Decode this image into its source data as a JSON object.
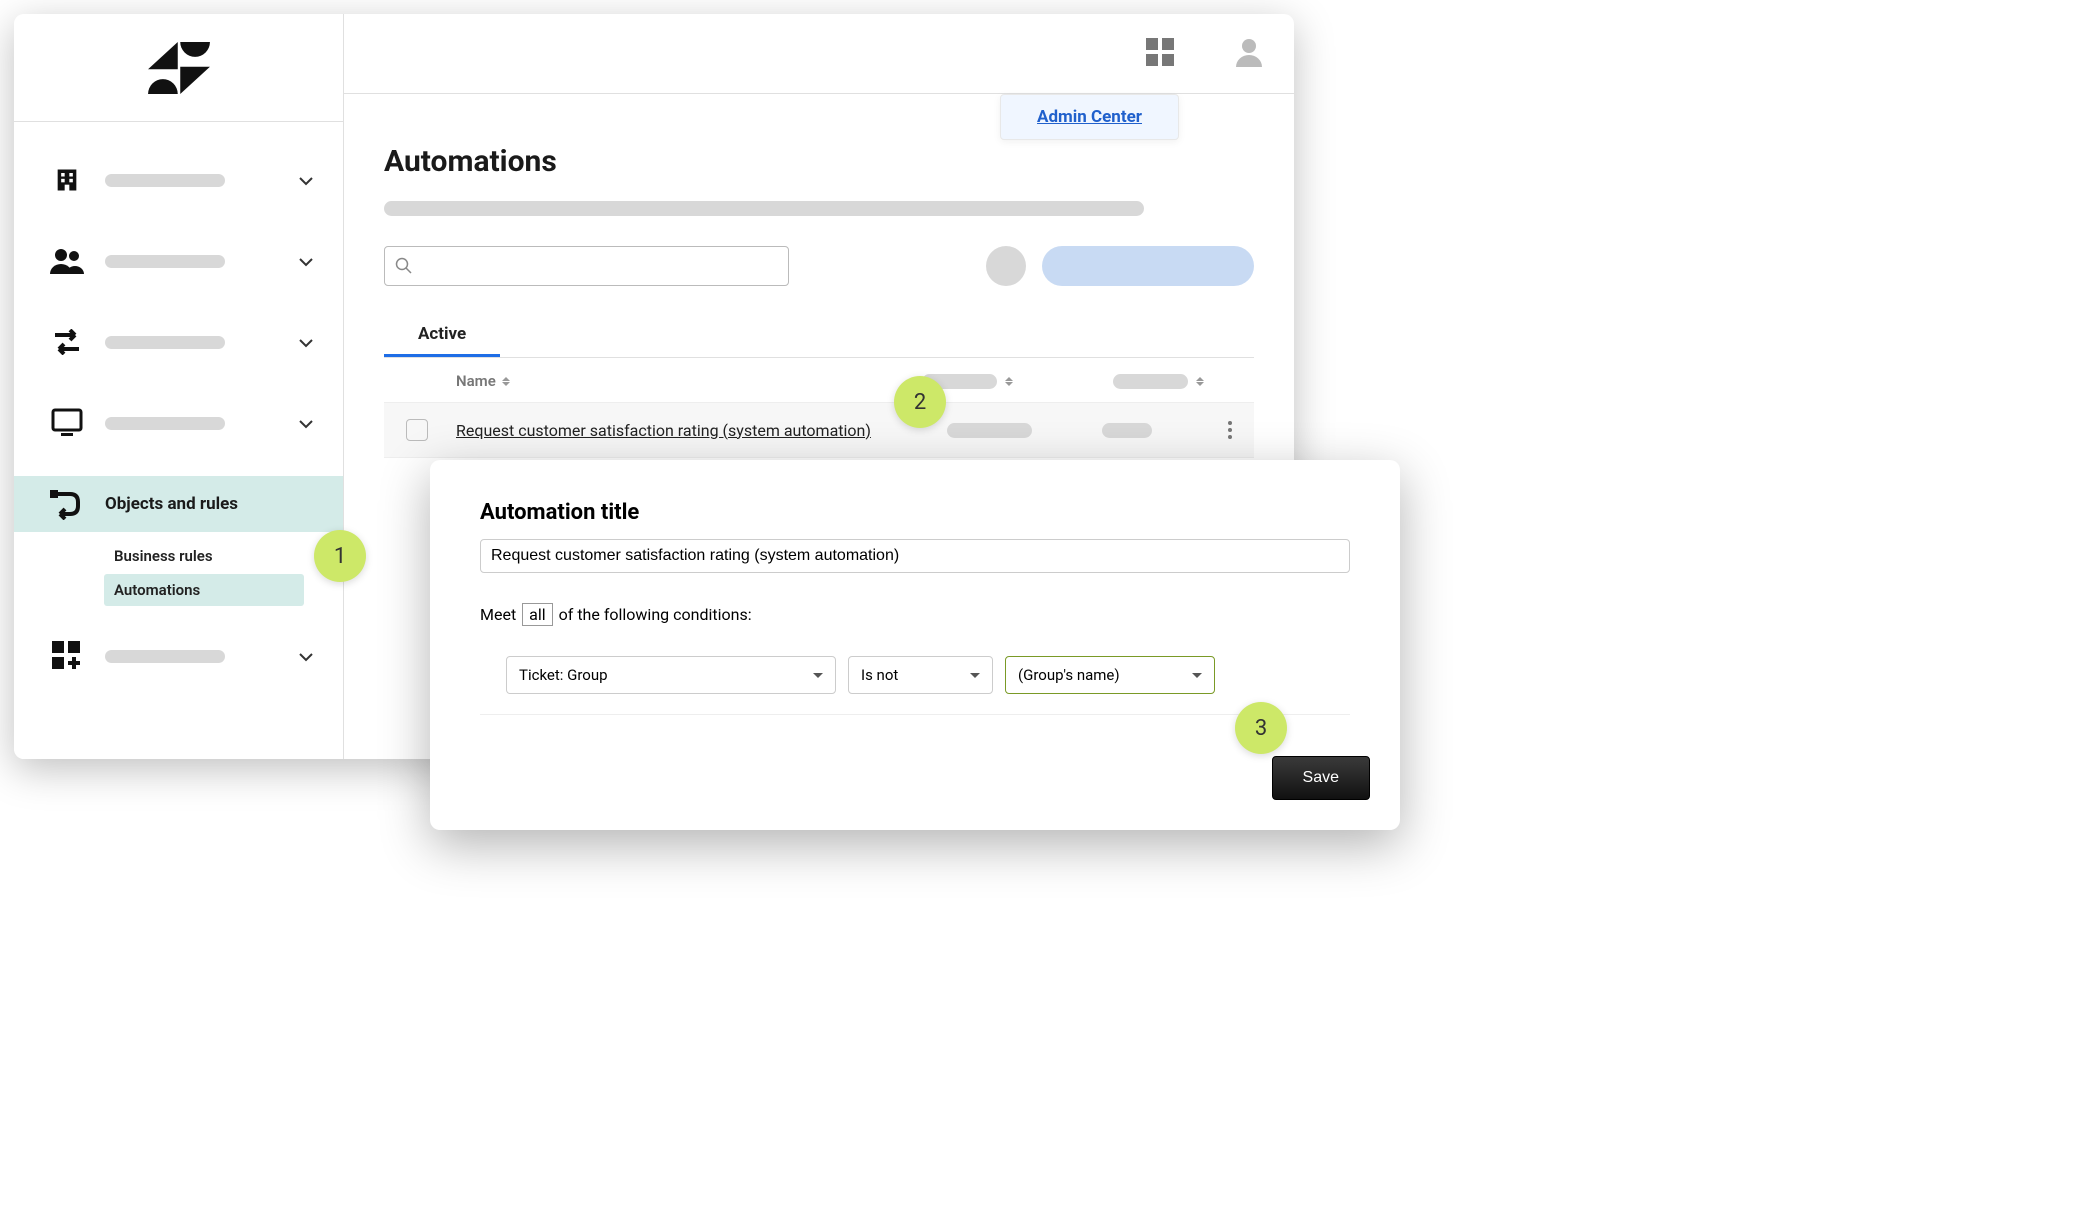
{
  "header": {
    "admin_center_label": "Admin Center"
  },
  "sidebar": {
    "items": [
      {
        "icon": "building"
      },
      {
        "icon": "people"
      },
      {
        "icon": "arrows"
      },
      {
        "icon": "monitor"
      },
      {
        "icon": "routes",
        "label": "Objects and rules"
      },
      {
        "icon": "apps-add"
      }
    ],
    "sub_section_label": "Business rules",
    "sub_items": [
      {
        "label": "Automations",
        "selected": true
      }
    ]
  },
  "main": {
    "title": "Automations",
    "tab_active": "Active",
    "table": {
      "col_name": "Name",
      "rows": [
        {
          "name": "Request customer satisfaction rating (system automation)"
        }
      ]
    }
  },
  "dialog": {
    "title": "Automation title",
    "title_input_value": "Request customer satisfaction rating (system automation)",
    "condition_prefix": "Meet",
    "condition_mode": "all",
    "condition_suffix": "of the following conditions:",
    "condition_field": "Ticket: Group",
    "condition_operator": "Is not",
    "condition_value": "(Group's name)",
    "save_label": "Save"
  },
  "steps": {
    "one": "1",
    "two": "2",
    "three": "3"
  }
}
